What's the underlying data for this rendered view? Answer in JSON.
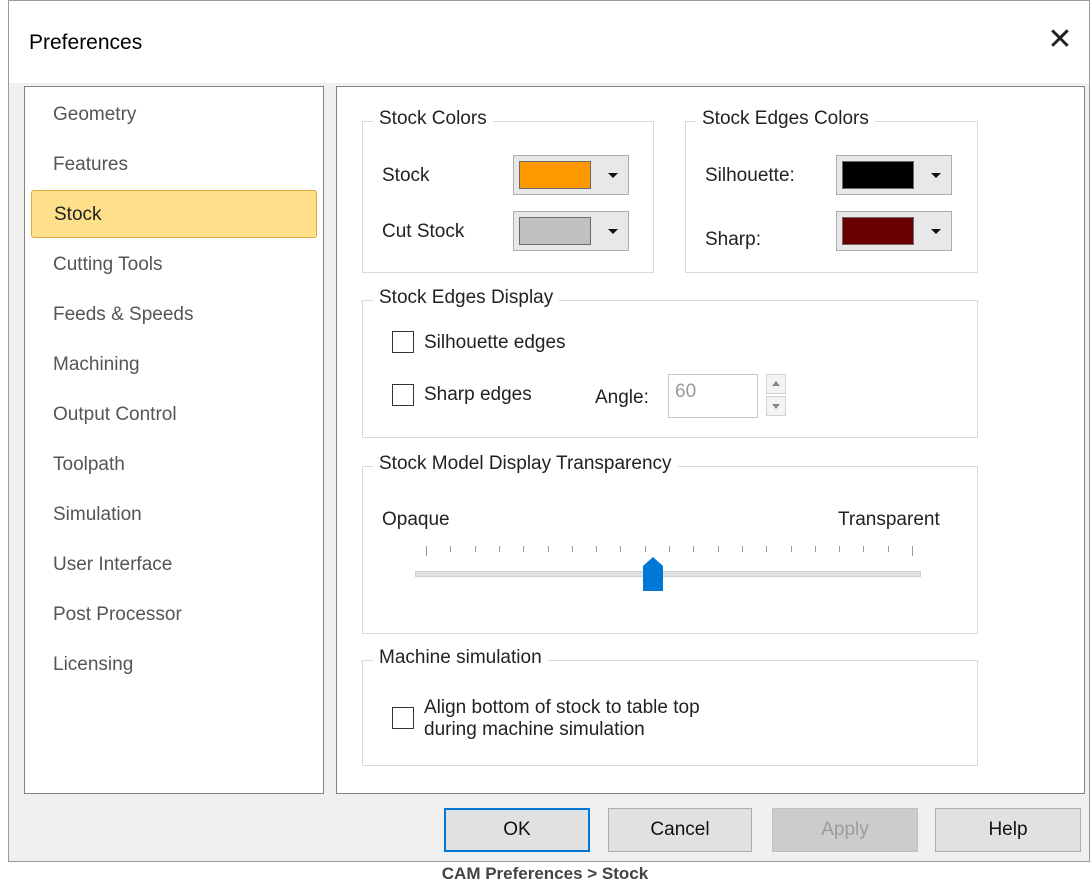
{
  "window": {
    "title": "Preferences"
  },
  "nav": {
    "items": [
      {
        "label": "Geometry"
      },
      {
        "label": "Features"
      },
      {
        "label": "Stock"
      },
      {
        "label": "Cutting Tools"
      },
      {
        "label": "Feeds & Speeds"
      },
      {
        "label": "Machining"
      },
      {
        "label": "Output Control"
      },
      {
        "label": "Toolpath"
      },
      {
        "label": "Simulation"
      },
      {
        "label": "User Interface"
      },
      {
        "label": "Post Processor"
      },
      {
        "label": "Licensing"
      }
    ],
    "selected": "Stock"
  },
  "stock_colors": {
    "legend": "Stock Colors",
    "stock_label": "Stock",
    "stock_color": "#ff9900",
    "cut_stock_label": "Cut Stock",
    "cut_stock_color": "#c0c0c0"
  },
  "edge_colors": {
    "legend": "Stock Edges Colors",
    "silhouette_label": "Silhouette:",
    "silhouette_color": "#000000",
    "sharp_label": "Sharp:",
    "sharp_color": "#6b0000"
  },
  "edges_display": {
    "legend": "Stock Edges Display",
    "silhouette_label": "Silhouette edges",
    "silhouette_checked": false,
    "sharp_label": "Sharp edges",
    "sharp_checked": false,
    "angle_label": "Angle:",
    "angle_value": "60"
  },
  "transparency": {
    "legend": "Stock Model Display Transparency",
    "min_label": "Opaque",
    "max_label": "Transparent",
    "value_fraction": 0.47
  },
  "machine_sim": {
    "legend": "Machine simulation",
    "align_label_line1": "Align bottom of stock to table top",
    "align_label_line2": "during machine simulation",
    "align_checked": false
  },
  "buttons": {
    "ok": "OK",
    "cancel": "Cancel",
    "apply": "Apply",
    "help": "Help"
  },
  "caption": "CAM Preferences > Stock"
}
